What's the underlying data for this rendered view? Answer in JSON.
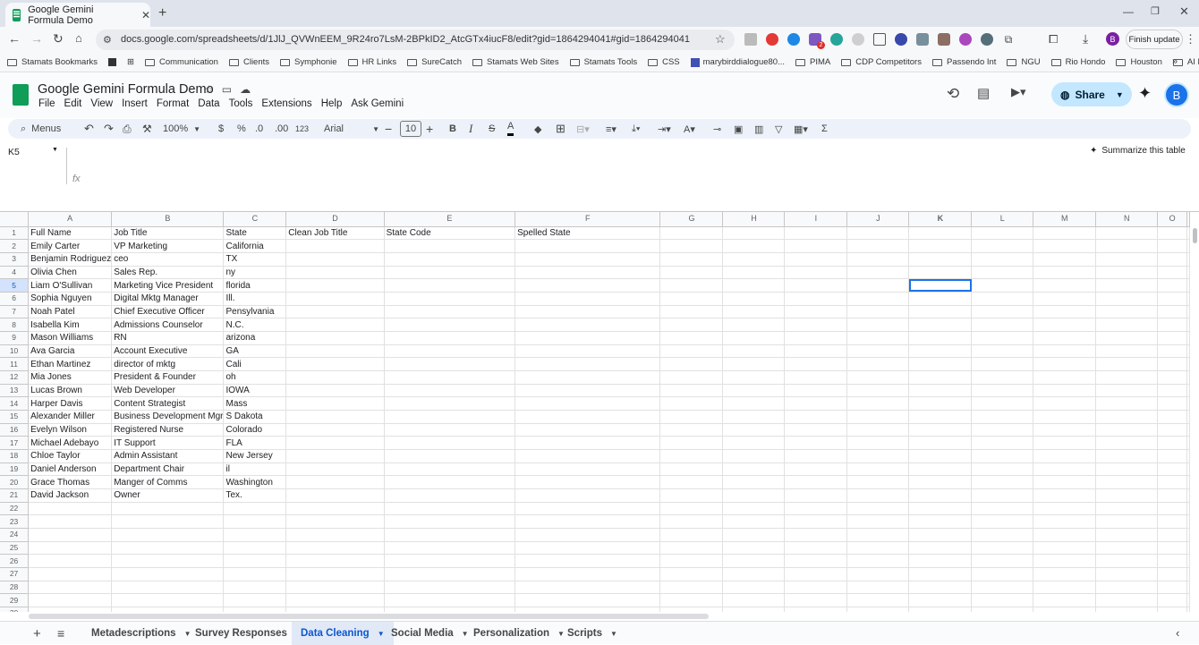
{
  "browser": {
    "tab_title": "Google Gemini Formula Demo",
    "url": "docs.google.com/spreadsheets/d/1JlJ_QVWnEEM_9R24ro7LsM-2BPkID2_AtcGTx4iucF8/edit?gid=1864294041#gid=1864294041",
    "update_button": "Finish update",
    "profile_initial": "B",
    "ext_badge": "2"
  },
  "bookmarks": [
    "Stamats Bookmarks",
    "Communication",
    "Clients",
    "Symphonie",
    "HR Links",
    "SureCatch",
    "Stamats Web Sites",
    "Stamats Tools",
    "CSS",
    "marybirddialogue80...",
    "PIMA",
    "CDP Competitors",
    "Passendo Int",
    "NGU",
    "Rio Hondo",
    "Houston",
    "AI Research"
  ],
  "doc": {
    "title": "Google Gemini Formula Demo",
    "menus": [
      "File",
      "Edit",
      "View",
      "Insert",
      "Format",
      "Data",
      "Tools",
      "Extensions",
      "Help",
      "Ask Gemini"
    ],
    "share_label": "Share",
    "avatar_initial": "B"
  },
  "toolbar": {
    "menus_label": "Menus",
    "zoom": "100%",
    "currency": "$",
    "percent": "%",
    "dec_less": ".0",
    "dec_more": ".00",
    "number_format": "123",
    "font": "Arial",
    "font_size": "10"
  },
  "formula": {
    "cell_ref": "K5",
    "fx": "fx",
    "summarize": "Summarize this table"
  },
  "grid": {
    "columns": [
      "A",
      "B",
      "C",
      "D",
      "E",
      "F",
      "G",
      "H",
      "I",
      "J",
      "K",
      "L",
      "M",
      "N",
      "O"
    ],
    "selected_cell": "K5",
    "rows": [
      [
        "Full Name",
        "Job Title",
        "State",
        "Clean Job Title",
        "State Code",
        "Spelled State"
      ],
      [
        "Emily Carter",
        "VP Marketing",
        "California"
      ],
      [
        "Benjamin Rodriguez",
        "ceo",
        "TX"
      ],
      [
        "Olivia Chen",
        "Sales Rep.",
        "ny"
      ],
      [
        "Liam O'Sullivan",
        "Marketing Vice President",
        "florida"
      ],
      [
        "Sophia Nguyen",
        "Digital Mktg Manager",
        "Ill."
      ],
      [
        "Noah Patel",
        "Chief Executive Officer",
        "Pensylvania"
      ],
      [
        "Isabella Kim",
        "Admissions Counselor",
        "N.C."
      ],
      [
        "Mason Williams",
        "RN",
        "arizona"
      ],
      [
        "Ava Garcia",
        "Account Executive",
        "GA"
      ],
      [
        "Ethan Martinez",
        "director of mktg",
        "Cali"
      ],
      [
        "Mia Jones",
        "President & Founder",
        "oh"
      ],
      [
        "Lucas Brown",
        "Web Developer",
        "IOWA"
      ],
      [
        "Harper Davis",
        "Content Strategist",
        "Mass"
      ],
      [
        "Alexander Miller",
        "Business Development Mgr",
        "S Dakota"
      ],
      [
        "Evelyn Wilson",
        "Registered Nurse",
        "Colorado"
      ],
      [
        "Michael Adebayo",
        "IT Support",
        "FLA"
      ],
      [
        "Chloe Taylor",
        "Admin Assistant",
        "New Jersey"
      ],
      [
        "Daniel Anderson",
        "Department Chair",
        "il"
      ],
      [
        "Grace Thomas",
        "Manger of Comms",
        "Washington"
      ],
      [
        "David Jackson",
        "Owner",
        "Tex."
      ],
      [],
      [],
      [],
      [],
      [],
      [],
      [],
      [],
      []
    ]
  },
  "sheets": [
    "Metadescriptions",
    "Survey Responses",
    "Data Cleaning",
    "Social Media",
    "Personalization",
    "Scripts"
  ],
  "active_sheet": "Data Cleaning"
}
